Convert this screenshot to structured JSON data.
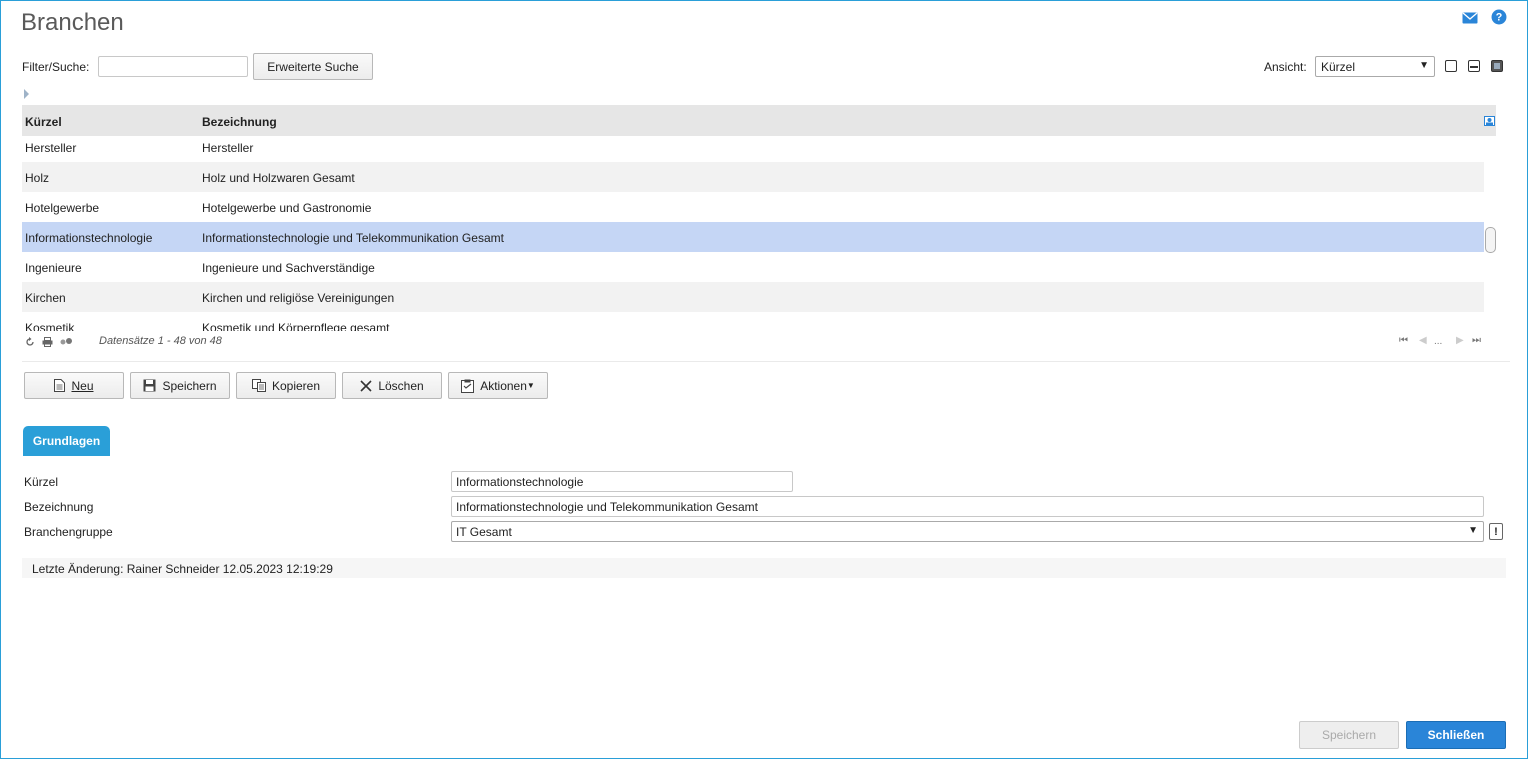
{
  "page": {
    "title": "Branchen",
    "icons": [
      "mail-icon",
      "help-icon"
    ]
  },
  "filter": {
    "label": "Filter/Suche:",
    "value": "",
    "extended_search_label": "Erweiterte Suche",
    "view_label": "Ansicht:",
    "view_value": "Kürzel"
  },
  "grid": {
    "columns": [
      "Kürzel",
      "Bezeichnung"
    ],
    "rows": [
      {
        "kuerzel": "Hersteller",
        "bezeichnung": "Hersteller"
      },
      {
        "kuerzel": "Holz",
        "bezeichnung": "Holz und Holzwaren Gesamt"
      },
      {
        "kuerzel": "Hotelgewerbe",
        "bezeichnung": "Hotelgewerbe und Gastronomie"
      },
      {
        "kuerzel": "Informationstechnologie",
        "bezeichnung": "Informationstechnologie und Telekommunikation Gesamt"
      },
      {
        "kuerzel": "Ingenieure",
        "bezeichnung": "Ingenieure und Sachverständige"
      },
      {
        "kuerzel": "Kirchen",
        "bezeichnung": "Kirchen und religiöse Vereinigungen"
      },
      {
        "kuerzel": "Kosmetik",
        "bezeichnung": "Kosmetik und Körperpflege gesamt"
      }
    ],
    "selected_index": 3,
    "record_info": "Datensätze 1 - 48 von 48",
    "pager_ellipsis": "..."
  },
  "toolbar": {
    "new_label": "Neu",
    "save_label": "Speichern",
    "copy_label": "Kopieren",
    "delete_label": "Löschen",
    "actions_label": "Aktionen"
  },
  "tabs": {
    "basics_label": "Grundlagen"
  },
  "form": {
    "kuerzel_label": "Kürzel",
    "kuerzel_value": "Informationstechnologie",
    "bezeichnung_label": "Bezeichnung",
    "bezeichnung_value": "Informationstechnologie und Telekommunikation Gesamt",
    "branchengruppe_label": "Branchengruppe",
    "branchengruppe_value": "IT Gesamt"
  },
  "status": {
    "last_change": "Letzte Änderung: Rainer Schneider 12.05.2023 12:19:29"
  },
  "footer": {
    "save_label": "Speichern",
    "close_label": "Schließen"
  },
  "colors": {
    "accent": "#2a9fd8",
    "selected_row": "#c5d6f5",
    "primary_button": "#2a85d8"
  }
}
